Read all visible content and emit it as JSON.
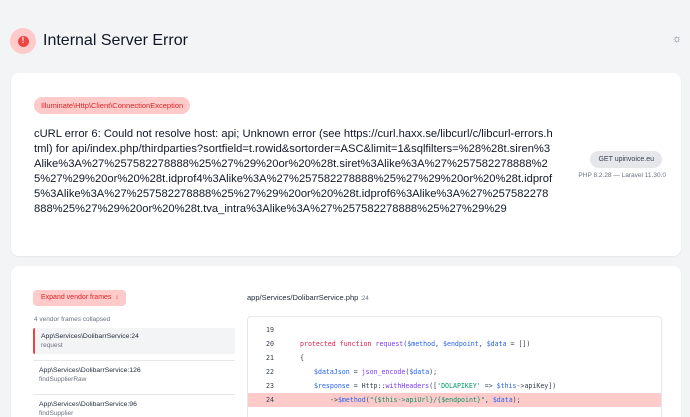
{
  "header": {
    "title": "Internal Server Error",
    "error_icon_glyph": "!",
    "theme_icon_glyph": "☼"
  },
  "exception": {
    "class": "Illuminate\\Http\\Client\\ConnectionException",
    "message": "cURL error 6: Could not resolve host: api; Unknown error (see https://curl.haxx.se/libcurl/c/libcurl-errors.html) for api/index.php/thirdparties?sortfield=t.rowid&sortorder=ASC&limit=1&sqlfilters=%28%28t.siren%3Alike%3A%27%257582278888%25%27%29%20or%20%28t.siret%3Alike%3A%27%257582278888%25%27%29%20or%20%28t.idprof4%3Alike%3A%27%257582278888%25%27%29%20or%20%28t.idprof5%3Alike%3A%27%257582278888%25%27%29%20or%20%28t.idprof6%3Alike%3A%27%257582278888%25%27%29%20or%20%28t.tva_intra%3Alike%3A%27%257582278888%25%27%29%29",
    "request": "GET upinvoice.eu",
    "versions": "PHP 8.2.28 — Laravel 11.30.0"
  },
  "trace": {
    "expand_label": "Expand vendor frames",
    "expand_icon_glyph": "⌃⌄",
    "collapsed_note": "4 vendor frames collapsed",
    "frames": [
      {
        "class": "App\\Services\\DolibarrService",
        "line": ":24",
        "function": "request"
      },
      {
        "class": "App\\Services\\DolibarrService",
        "line": ":126",
        "function": "findSupplierRaw"
      },
      {
        "class": "App\\Services\\DolibarrService",
        "line": ":96",
        "function": "findSupplier"
      }
    ],
    "file": "app/Services/DolibarrService.php",
    "file_line": ":24",
    "code": [
      {
        "n": "19",
        "t": ""
      },
      {
        "n": "20",
        "t": "protected function request($method, $endpoint, $data = [])"
      },
      {
        "n": "21",
        "t": "{"
      },
      {
        "n": "22",
        "t": "$dataJson = json_encode($data);"
      },
      {
        "n": "23",
        "t": "$response = Http::withHeaders(['DOLAPIKEY' => $this->apiKey])"
      },
      {
        "n": "24",
        "t": "->$method(\"{$this->apiUrl}/{$endpoint}\", $data);"
      }
    ]
  },
  "colors": {
    "accent": "#ef4444",
    "badge_bg": "#fecaca",
    "badge_text": "#dc2626"
  }
}
